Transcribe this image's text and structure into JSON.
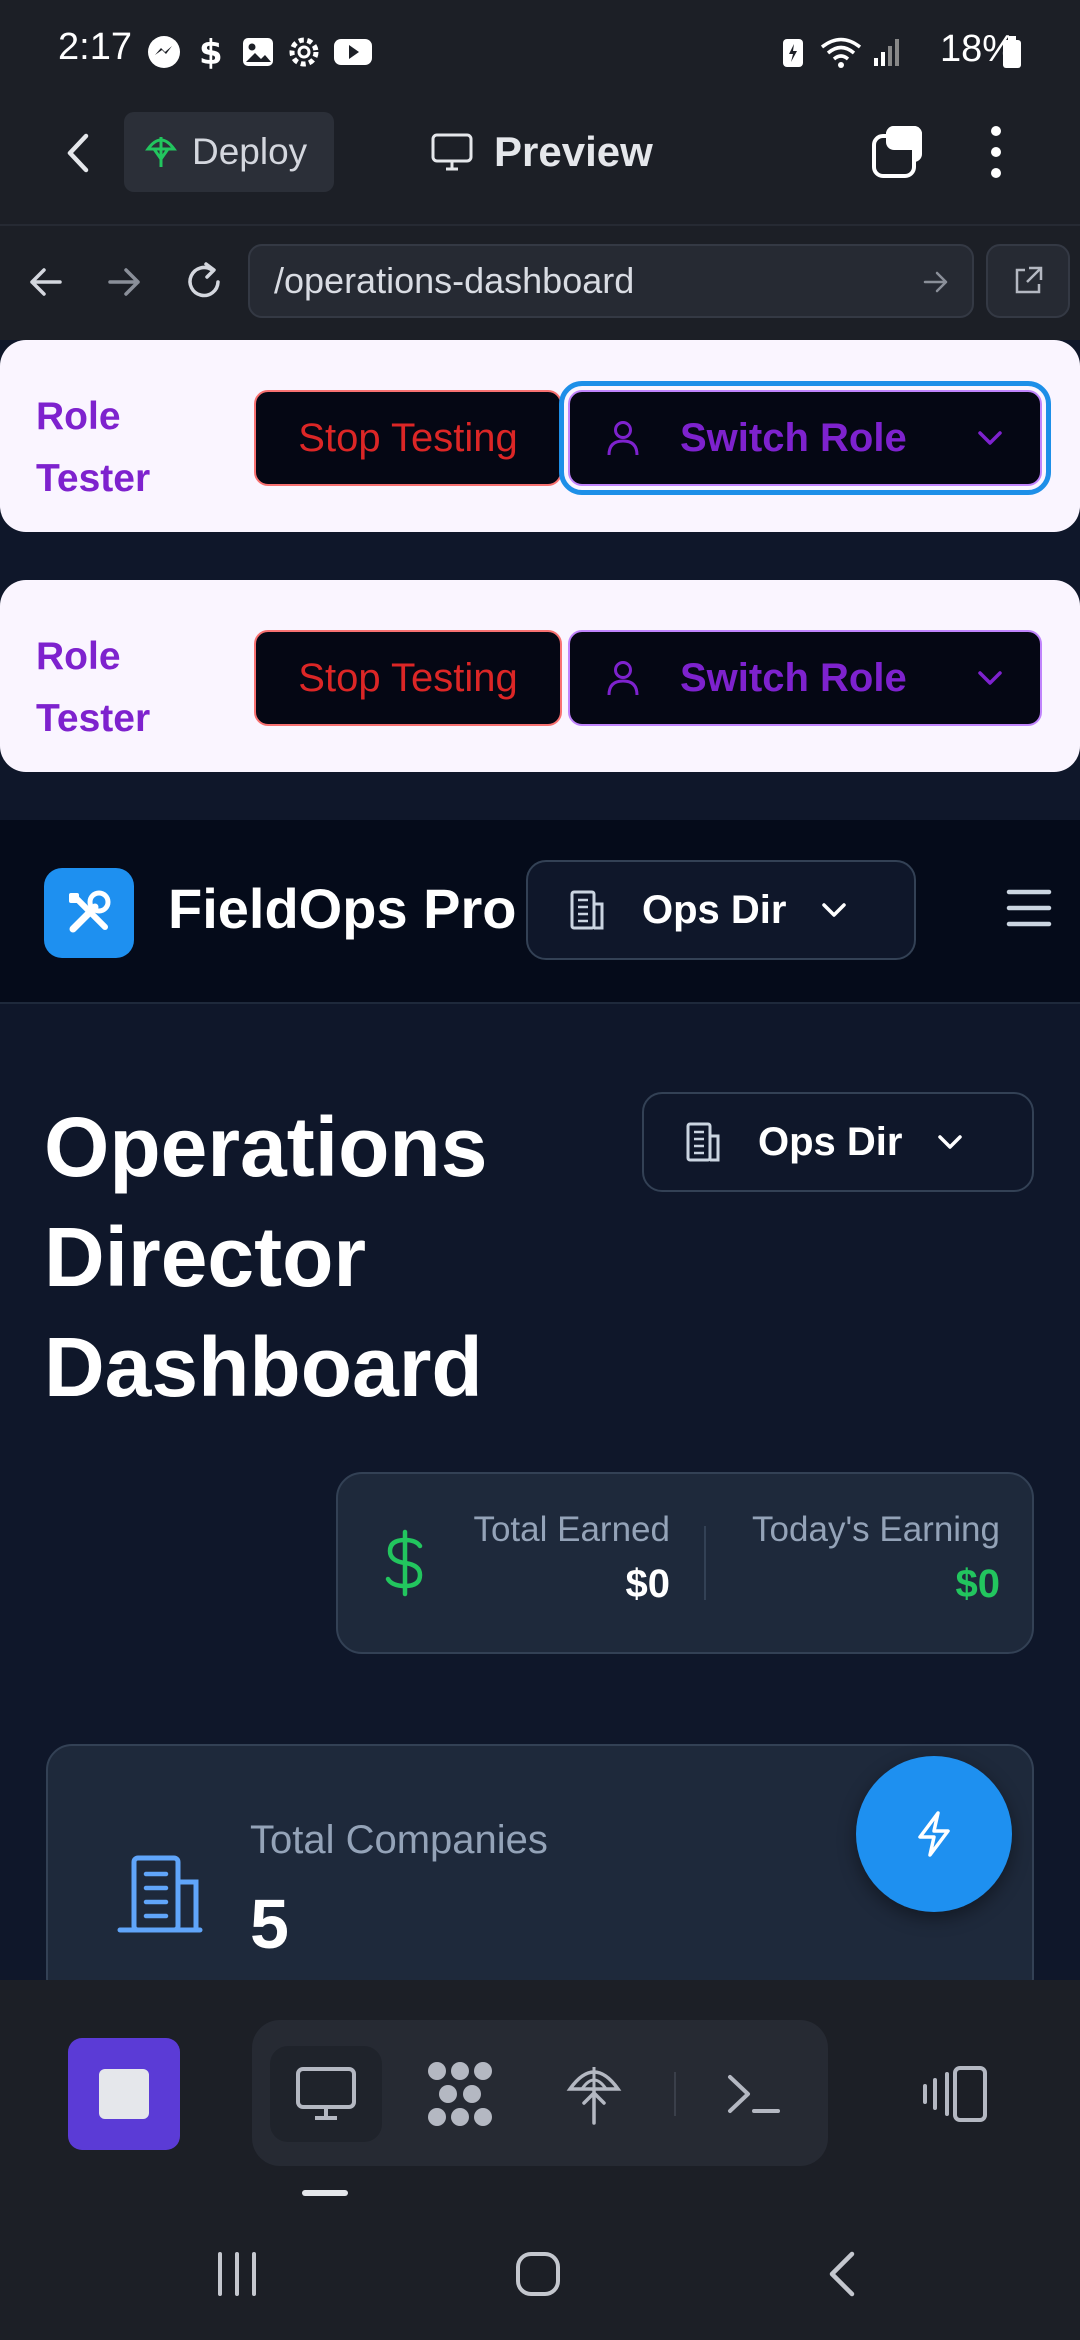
{
  "status_bar": {
    "time": "2:17",
    "battery": "18%"
  },
  "app_bar": {
    "deploy_label": "Deploy",
    "preview_label": "Preview"
  },
  "browser": {
    "url": "/operations-dashboard"
  },
  "role_tester": [
    {
      "title": "Role Tester",
      "stop_label": "Stop Testing",
      "switch_label": "Switch Role"
    },
    {
      "title": "Role Tester",
      "stop_label": "Stop Testing",
      "switch_label": "Switch Role"
    }
  ],
  "header": {
    "app_name": "FieldOps Pro",
    "role_select": "Ops Dir"
  },
  "dashboard": {
    "title": "Operations Director Dashboard",
    "role_select": "Ops Dir",
    "earnings": {
      "total_label": "Total Earned",
      "total_value": "$0",
      "today_label": "Today's Earning",
      "today_value": "$0"
    },
    "stats": [
      {
        "label": "Total Companies",
        "value": "5"
      }
    ]
  },
  "colors": {
    "accent_blue": "#1e90f0",
    "role_purple": "#7e22ce",
    "stop_red": "#dc2626",
    "earning_green": "#22c55e"
  },
  "icons": [
    "messenger-icon",
    "dollar-icon",
    "gallery-icon",
    "settings-icon",
    "youtube-icon",
    "wifi-icon",
    "signal-icon",
    "battery-icon",
    "back-arrow-icon",
    "deploy-icon",
    "monitor-icon",
    "tabs-icon",
    "more-vert-icon",
    "reload-icon",
    "external-link-icon",
    "user-icon",
    "chevron-down-icon",
    "tools-icon",
    "building-icon",
    "hamburger-menu-icon",
    "lightning-icon",
    "terminal-icon"
  ]
}
